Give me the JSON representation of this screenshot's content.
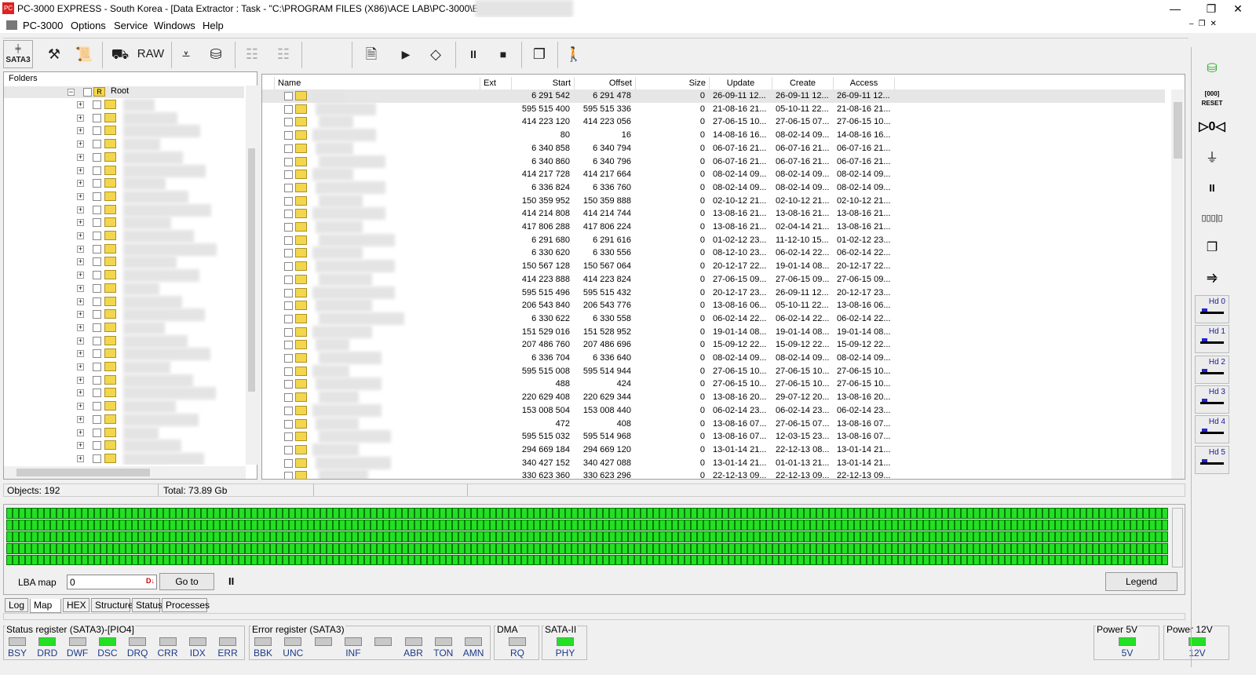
{
  "window": {
    "title": "PC-3000 EXPRESS - South Korea - [Data Extractor : Task - \"C:\\PROGRAM FILES (X86)\\ACE LAB\\PC-3000\\E",
    "controls": [
      "—",
      "❐",
      "✕"
    ]
  },
  "menu": [
    "PC-3000",
    "Options",
    "Service",
    "Windows",
    "Help"
  ],
  "toolbar": {
    "sata_label": "SATA3",
    "raw_label": "RAW"
  },
  "folders": {
    "header": "Folders",
    "root": "Root",
    "node_count": 29
  },
  "table": {
    "columns": [
      "Name",
      "Ext",
      "Start",
      "Offset",
      "Size",
      "Update",
      "Create",
      "Access"
    ],
    "rows": [
      [
        "6 291 542",
        "6 291 478",
        "0",
        "26-09-11 12...",
        "26-09-11 12...",
        "26-09-11 12..."
      ],
      [
        "595 515 400",
        "595 515 336",
        "0",
        "21-08-16 21...",
        "05-10-11 22...",
        "21-08-16 21..."
      ],
      [
        "414 223 120",
        "414 223 056",
        "0",
        "27-06-15 10...",
        "27-06-15 07...",
        "27-06-15 10..."
      ],
      [
        "80",
        "16",
        "0",
        "14-08-16 16...",
        "08-02-14 09...",
        "14-08-16 16..."
      ],
      [
        "6 340 858",
        "6 340 794",
        "0",
        "06-07-16 21...",
        "06-07-16 21...",
        "06-07-16 21..."
      ],
      [
        "6 340 860",
        "6 340 796",
        "0",
        "06-07-16 21...",
        "06-07-16 21...",
        "06-07-16 21..."
      ],
      [
        "414 217 728",
        "414 217 664",
        "0",
        "08-02-14 09...",
        "08-02-14 09...",
        "08-02-14 09..."
      ],
      [
        "6 336 824",
        "6 336 760",
        "0",
        "08-02-14 09...",
        "08-02-14 09...",
        "08-02-14 09..."
      ],
      [
        "150 359 952",
        "150 359 888",
        "0",
        "02-10-12 21...",
        "02-10-12 21...",
        "02-10-12 21..."
      ],
      [
        "414 214 808",
        "414 214 744",
        "0",
        "13-08-16 21...",
        "13-08-16 21...",
        "13-08-16 21..."
      ],
      [
        "417 806 288",
        "417 806 224",
        "0",
        "13-08-16 21...",
        "02-04-14 21...",
        "13-08-16 21..."
      ],
      [
        "6 291 680",
        "6 291 616",
        "0",
        "01-02-12 23...",
        "11-12-10 15...",
        "01-02-12 23..."
      ],
      [
        "6 330 620",
        "6 330 556",
        "0",
        "08-12-10 23...",
        "06-02-14 22...",
        "06-02-14 22..."
      ],
      [
        "150 567 128",
        "150 567 064",
        "0",
        "20-12-17 22...",
        "19-01-14 08...",
        "20-12-17 22..."
      ],
      [
        "414 223 888",
        "414 223 824",
        "0",
        "27-06-15 09...",
        "27-06-15 09...",
        "27-06-15 09..."
      ],
      [
        "595 515 496",
        "595 515 432",
        "0",
        "20-12-17 23...",
        "26-09-11 12...",
        "20-12-17 23..."
      ],
      [
        "206 543 840",
        "206 543 776",
        "0",
        "13-08-16 06...",
        "05-10-11 22...",
        "13-08-16 06..."
      ],
      [
        "6 330 622",
        "6 330 558",
        "0",
        "06-02-14 22...",
        "06-02-14 22...",
        "06-02-14 22..."
      ],
      [
        "151 529 016",
        "151 528 952",
        "0",
        "19-01-14 08...",
        "19-01-14 08...",
        "19-01-14 08..."
      ],
      [
        "207 486 760",
        "207 486 696",
        "0",
        "15-09-12 22...",
        "15-09-12 22...",
        "15-09-12 22..."
      ],
      [
        "6 336 704",
        "6 336 640",
        "0",
        "08-02-14 09...",
        "08-02-14 09...",
        "08-02-14 09..."
      ],
      [
        "595 515 008",
        "595 514 944",
        "0",
        "27-06-15 10...",
        "27-06-15 10...",
        "27-06-15 10..."
      ],
      [
        "488",
        "424",
        "0",
        "27-06-15 10...",
        "27-06-15 10...",
        "27-06-15 10..."
      ],
      [
        "220 629 408",
        "220 629 344",
        "0",
        "13-08-16 20...",
        "29-07-12 20...",
        "13-08-16 20..."
      ],
      [
        "153 008 504",
        "153 008 440",
        "0",
        "06-02-14 23...",
        "06-02-14 23...",
        "06-02-14 23..."
      ],
      [
        "472",
        "408",
        "0",
        "13-08-16 07...",
        "27-06-15 07...",
        "13-08-16 07..."
      ],
      [
        "595 515 032",
        "595 514 968",
        "0",
        "13-08-16 07...",
        "12-03-15 23...",
        "13-08-16 07..."
      ],
      [
        "294 669 184",
        "294 669 120",
        "0",
        "13-01-14 21...",
        "22-12-13 08...",
        "13-01-14 21..."
      ],
      [
        "340 427 152",
        "340 427 088",
        "0",
        "13-01-14 21...",
        "01-01-13 21...",
        "13-01-14 21..."
      ],
      [
        "330 623 360",
        "330 623 296",
        "0",
        "22-12-13 09...",
        "22-12-13 09...",
        "22-12-13 09..."
      ]
    ]
  },
  "status": {
    "objects": "Objects: 192",
    "total": "Total: 73.89 Gb"
  },
  "map": {
    "lba_label": "LBA map",
    "lba_value": "0",
    "goto": "Go to",
    "pause": "II",
    "legend": "Legend",
    "cell_color": "#22e022"
  },
  "tabs": [
    "Log",
    "Map",
    "HEX",
    "Structure",
    "Status",
    "Processes"
  ],
  "active_tab": "Map",
  "registers": {
    "status": {
      "title": "Status register (SATA3)-[PIO4]",
      "leds": [
        [
          "BSY",
          false
        ],
        [
          "DRD",
          true
        ],
        [
          "DWF",
          false
        ],
        [
          "DSC",
          true
        ],
        [
          "DRQ",
          false
        ],
        [
          "CRR",
          false
        ],
        [
          "IDX",
          false
        ],
        [
          "ERR",
          false
        ]
      ]
    },
    "error": {
      "title": "Error register (SATA3)",
      "leds": [
        [
          "BBK",
          false
        ],
        [
          "UNC",
          false
        ],
        [
          "",
          false
        ],
        [
          "INF",
          false
        ],
        [
          "",
          false
        ],
        [
          "ABR",
          false
        ],
        [
          "TON",
          false
        ],
        [
          "AMN",
          false
        ]
      ]
    },
    "dma": {
      "title": "DMA",
      "leds": [
        [
          "RQ",
          false
        ]
      ]
    },
    "sata": {
      "title": "SATA-II",
      "leds": [
        [
          "PHY",
          true
        ]
      ]
    },
    "power5": {
      "title": "Power 5V",
      "leds": [
        [
          "5V",
          true
        ]
      ]
    },
    "power12": {
      "title": "Power 12V",
      "leds": [
        [
          "12V",
          true
        ]
      ]
    }
  },
  "heads": [
    "Hd 0",
    "Hd 1",
    "Hd 2",
    "Hd 3",
    "Hd 4",
    "Hd 5"
  ],
  "right_toolbar": {
    "reset_label": "RESET"
  }
}
